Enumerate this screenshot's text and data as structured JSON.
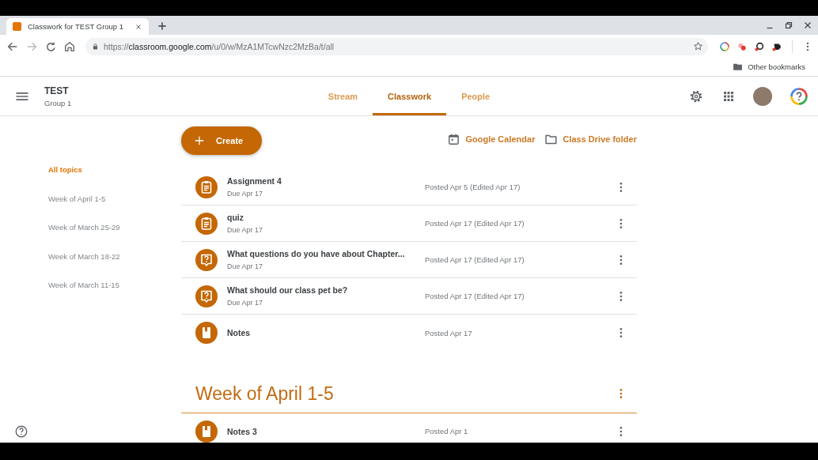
{
  "browser": {
    "tab_title": "Classwork for TEST Group 1",
    "url": "https://**classroom.google.com**/u/0/w/MzA1MTcwNzc2MzBa/t/all",
    "bookmarks": [
      "Other bookmarks"
    ]
  },
  "class": {
    "name": "TEST",
    "section": "Group 1"
  },
  "nav_tabs": [
    {
      "label": "Stream",
      "selected": false
    },
    {
      "label": "Classwork",
      "selected": true
    },
    {
      "label": "People",
      "selected": false
    }
  ],
  "create_button": "Create",
  "links": [
    {
      "kind": "calendar",
      "label": "Google Calendar"
    },
    {
      "kind": "folder",
      "label": "Class Drive folder"
    }
  ],
  "topics": [
    {
      "label": "All topics",
      "selected": true
    },
    {
      "label": "Week of April 1-5",
      "selected": false
    },
    {
      "label": "Week of March 25-29",
      "selected": false
    },
    {
      "label": "Week of March 18-22",
      "selected": false
    },
    {
      "label": "Week of March 11-15",
      "selected": false
    }
  ],
  "items": [
    {
      "kind": "assignment",
      "title": "Assignment 4",
      "due": "Due Apr 17",
      "posted": "Posted Apr 5 (Edited Apr 17)"
    },
    {
      "kind": "assignment",
      "title": "quiz",
      "due": "Due Apr 17",
      "posted": "Posted Apr 17 (Edited Apr 17)"
    },
    {
      "kind": "question",
      "title": "What questions do you have about Chapter...",
      "due": "Due Apr 17",
      "posted": "Posted Apr 17 (Edited Apr 17)"
    },
    {
      "kind": "question",
      "title": "What should our class pet be?",
      "due": "Due Apr 17",
      "posted": "Posted Apr 17 (Edited Apr 17)"
    },
    {
      "kind": "material",
      "title": "Notes",
      "posted": "Posted Apr 17"
    }
  ],
  "sections": [
    {
      "title": "Week of April 1-5",
      "items": [
        {
          "kind": "material",
          "title": "Notes 3",
          "posted": "Posted Apr 1"
        }
      ]
    }
  ]
}
